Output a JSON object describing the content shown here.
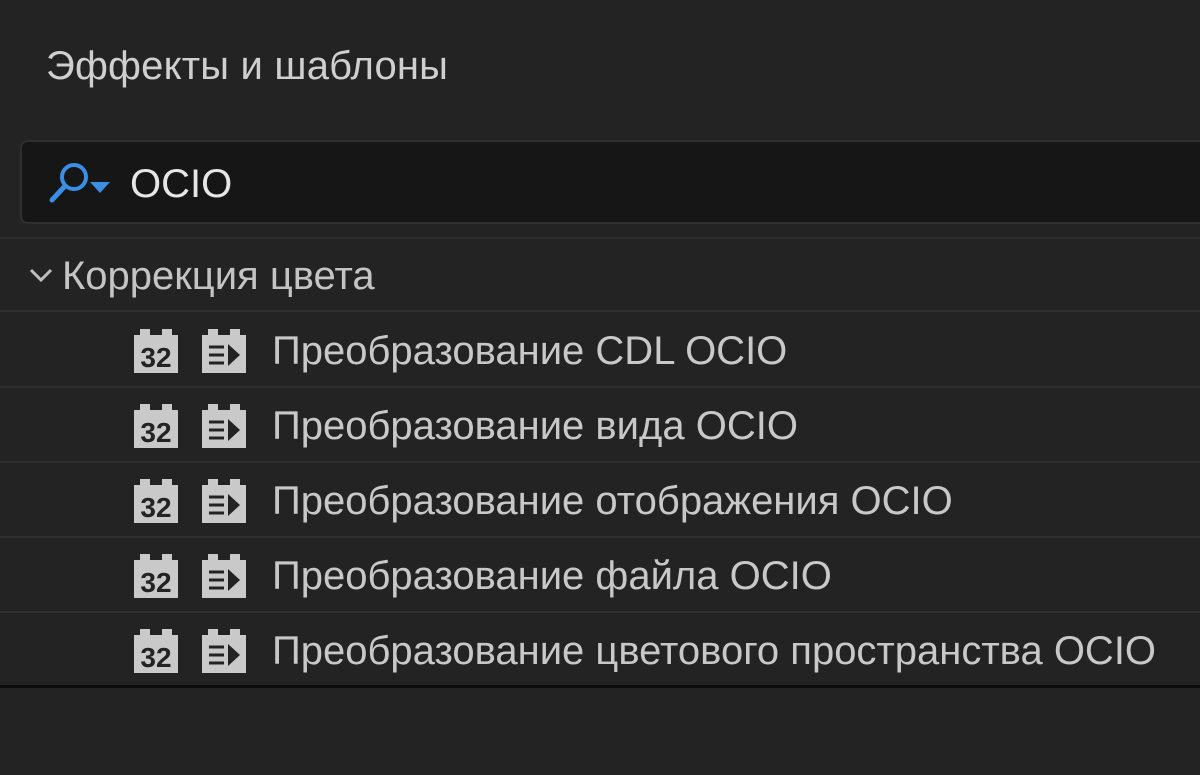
{
  "panel": {
    "title": "Эффекты и шаблоны"
  },
  "search": {
    "value": "OCIO",
    "icon": "search-icon"
  },
  "category": {
    "label": "Коррекция цвета",
    "icon": "chevron-down-icon"
  },
  "effects": [
    {
      "label": "Преобразование CDL OCIO",
      "badge": "32",
      "icons": [
        "32-bit-icon",
        "accelerated-effect-icon"
      ]
    },
    {
      "label": "Преобразование вида OCIO",
      "badge": "32",
      "icons": [
        "32-bit-icon",
        "accelerated-effect-icon"
      ]
    },
    {
      "label": "Преобразование отображения OCIO",
      "badge": "32",
      "icons": [
        "32-bit-icon",
        "accelerated-effect-icon"
      ]
    },
    {
      "label": "Преобразование файла OCIO",
      "badge": "32",
      "icons": [
        "32-bit-icon",
        "accelerated-effect-icon"
      ]
    },
    {
      "label": "Преобразование цветового пространства OCIO",
      "badge": "32",
      "icons": [
        "32-bit-icon",
        "accelerated-effect-icon"
      ]
    }
  ],
  "colors": {
    "accent": "#3a8ee6",
    "background": "#232323",
    "badge": "#c9c9c9"
  }
}
